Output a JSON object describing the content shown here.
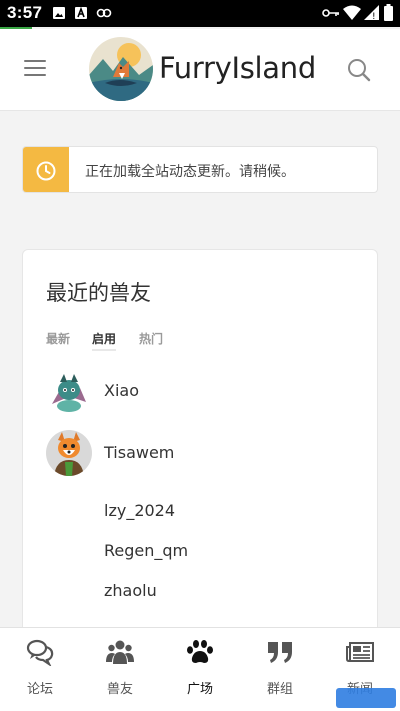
{
  "status_bar": {
    "time": "3:57"
  },
  "header": {
    "brand": "FurryIsland"
  },
  "notice": {
    "text": "正在加载全站动态更新。请稍候。"
  },
  "recent_friends": {
    "title": "最近的兽友",
    "tabs": [
      {
        "label": "最新",
        "active": false
      },
      {
        "label": "启用",
        "active": true
      },
      {
        "label": "热门",
        "active": false
      }
    ],
    "items": [
      {
        "name": "Xiao",
        "avatar": "dragon-avatar"
      },
      {
        "name": "Tisawem",
        "avatar": "fox-avatar"
      },
      {
        "name": "lzy_2024",
        "avatar": ""
      },
      {
        "name": "Regen_qm",
        "avatar": ""
      },
      {
        "name": "zhaolu",
        "avatar": ""
      }
    ]
  },
  "bottom_nav": [
    {
      "label": "论坛",
      "icon": "forum-icon",
      "active": false
    },
    {
      "label": "兽友",
      "icon": "friends-icon",
      "active": false
    },
    {
      "label": "广场",
      "icon": "paw-icon",
      "active": true
    },
    {
      "label": "群组",
      "icon": "quote-icon",
      "active": false
    },
    {
      "label": "新闻",
      "icon": "newspaper-icon",
      "active": false
    }
  ],
  "colors": {
    "notice_accent": "#f4b942",
    "loading_bar": "#3aa845"
  }
}
